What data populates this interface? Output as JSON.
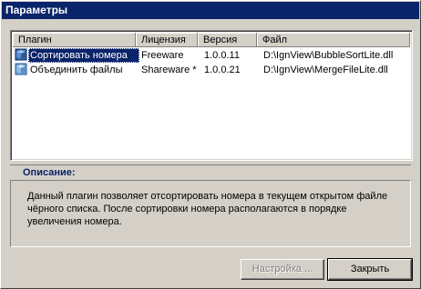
{
  "window": {
    "title": "Параметры"
  },
  "table": {
    "columns": [
      "Плагин",
      "Лицензия",
      "Версия",
      "Файл"
    ],
    "rows": [
      {
        "plugin": "Сортировать номера",
        "license": "Freeware",
        "version": "1.0.0.11",
        "file": "D:\\IgnView\\BubbleSortLite.dll",
        "selected": true,
        "icon": "plugin-icon"
      },
      {
        "plugin": "Объединить файлы",
        "license": "Shareware *",
        "version": "1.0.0.21",
        "file": "D:\\IgnView\\MergeFileLite.dll",
        "selected": false,
        "icon": "plugin-icon"
      }
    ]
  },
  "description": {
    "label": "Описание:",
    "text": "Данный плагин позволяет отсортировать номера в текущем открытом файле чёрного списка. После сортировки номера располагаются в порядке увеличения номера."
  },
  "buttons": {
    "settings_label": "Настройка ...",
    "settings_enabled": false,
    "close_label": "Закрыть"
  },
  "colors": {
    "titlebar": "#0a246a",
    "face": "#d4d0c8",
    "selection": "#0a246a",
    "desc_label": "#0a246a"
  }
}
